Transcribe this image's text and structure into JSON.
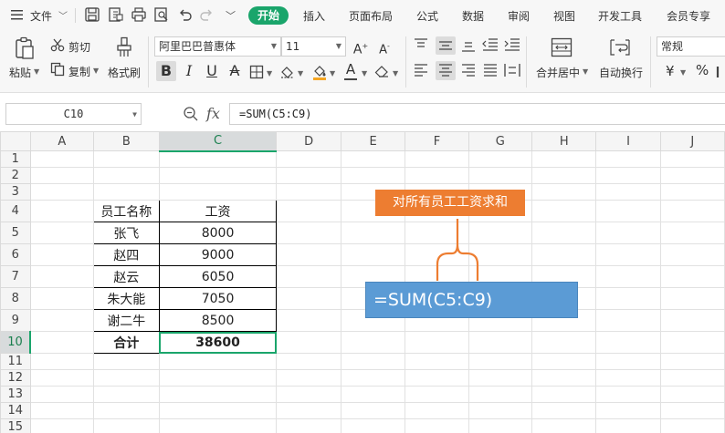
{
  "menubar": {
    "menu_label": "文件",
    "tabs": [
      "开始",
      "插入",
      "页面布局",
      "公式",
      "数据",
      "审阅",
      "视图",
      "开发工具",
      "会员专享"
    ]
  },
  "ribbon": {
    "paste": "粘贴",
    "cut": "剪切",
    "copy": "复制",
    "format_painter": "格式刷",
    "font_name": "阿里巴巴普惠体",
    "font_size": "11",
    "merge_center": "合并居中",
    "auto_wrap": "自动换行",
    "number_format": "常规",
    "currency_symbol": "¥",
    "percent_symbol": "%"
  },
  "formula_bar": {
    "name_box": "C10",
    "fx": "fx",
    "formula": "=SUM(C5:C9)"
  },
  "columns": [
    "A",
    "B",
    "C",
    "D",
    "E",
    "F",
    "G",
    "H",
    "I",
    "J"
  ],
  "rows": [
    "1",
    "2",
    "3",
    "4",
    "5",
    "6",
    "7",
    "8",
    "9",
    "10",
    "11",
    "12",
    "13",
    "14",
    "15"
  ],
  "table": {
    "headers": [
      "员工名称",
      "工资"
    ],
    "rows": [
      [
        "张飞",
        "8000"
      ],
      [
        "赵四",
        "9000"
      ],
      [
        "赵云",
        "6050"
      ],
      [
        "朱大能",
        "7050"
      ],
      [
        "谢二牛",
        "8500"
      ]
    ],
    "total_label": "合计",
    "total_value": "38600"
  },
  "annotation": {
    "callout": "对所有员工工资求和",
    "formula": "=SUM(C5:C9)"
  },
  "colors": {
    "accent": "#1aa56b",
    "callout": "#ed7d31",
    "formula_box": "#5b9bd5"
  }
}
